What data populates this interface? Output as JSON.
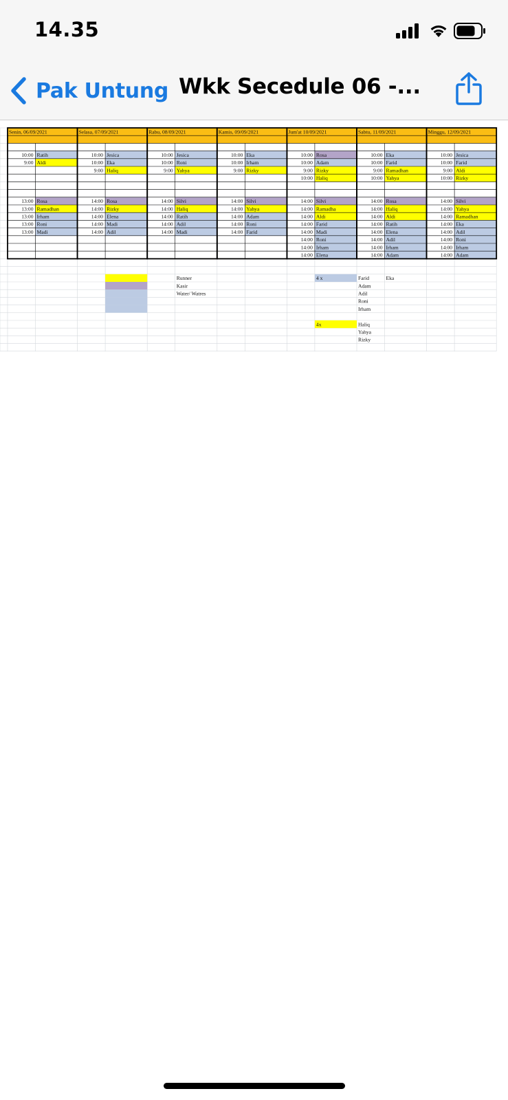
{
  "status_bar": {
    "time": "14.35"
  },
  "nav": {
    "back_label": "Pak Untung",
    "title": "Wkk Secedule 06 -..."
  },
  "colors": {
    "header": "#fbbd14",
    "runner": "#ffff00",
    "kasir": "#b3a4c8",
    "water": "#bccbe3",
    "accent": "#1a7ae0"
  },
  "icons": {
    "back": "chevron-left-icon",
    "share": "share-icon",
    "signal": "cellular-signal-icon",
    "wifi": "wifi-icon",
    "battery": "battery-icon"
  },
  "schedule": {
    "days": [
      {
        "header": "Senin, 06/09/2021",
        "morning": [
          [
            "10:00",
            "Ratih",
            "w"
          ],
          [
            "9:00",
            "Aldi",
            "y"
          ]
        ],
        "afternoon": [
          [
            "13:00",
            "Rosa",
            "p"
          ],
          [
            "13:00",
            "Ramadhan",
            "y"
          ],
          [
            "13:00",
            "Irham",
            "w"
          ],
          [
            "13:00",
            "Roni",
            "w"
          ],
          [
            "13:00",
            "Madi",
            "w"
          ]
        ]
      },
      {
        "header": "Selasa, 07/09/2021",
        "morning": [
          [
            "10:00",
            "Jesica",
            "w"
          ],
          [
            "10:00",
            "Eka",
            "w"
          ],
          [
            "9:00",
            "Haliq",
            "y"
          ]
        ],
        "afternoon": [
          [
            "14:00",
            "Rosa",
            "p"
          ],
          [
            "14:00",
            "Rizky",
            "y"
          ],
          [
            "14:00",
            "Elena",
            "w"
          ],
          [
            "14:00",
            "Madi",
            "w"
          ],
          [
            "14:00",
            "Adil",
            "w"
          ]
        ]
      },
      {
        "header": "Rabu, 08/09/2021",
        "morning": [
          [
            "10:00",
            "Jesica",
            "w"
          ],
          [
            "10:00",
            "Roni",
            "w"
          ],
          [
            "9:00",
            "Yahya",
            "y"
          ]
        ],
        "afternoon": [
          [
            "14:00",
            "Silvi",
            "p"
          ],
          [
            "14:00",
            "Haliq",
            "y"
          ],
          [
            "14:00",
            "Ratih",
            "w"
          ],
          [
            "14:00",
            "Adil",
            "w"
          ],
          [
            "14:00",
            "Madi",
            "w"
          ]
        ]
      },
      {
        "header": "Kamis, 09/09/2021",
        "morning": [
          [
            "10:00",
            "Eka",
            "w"
          ],
          [
            "10:00",
            "Irham",
            "w"
          ],
          [
            "9:00",
            "Rizky",
            "y"
          ]
        ],
        "afternoon": [
          [
            "14:00",
            "Silvi",
            "p"
          ],
          [
            "14:00",
            "Yahya",
            "y"
          ],
          [
            "14:00",
            "Adam",
            "w"
          ],
          [
            "14:00",
            "Roni",
            "w"
          ],
          [
            "14:00",
            "Farid",
            "w"
          ]
        ]
      },
      {
        "header": "Jum'at 10/09/2021",
        "morning": [
          [
            "10:00",
            "Rosa",
            "p"
          ],
          [
            "10:00",
            "Adam",
            "w"
          ],
          [
            "9:00",
            "Rizky",
            "y"
          ],
          [
            "10:00",
            "Haliq",
            "y"
          ]
        ],
        "afternoon": [
          [
            "14:00",
            "Silvi",
            "p"
          ],
          [
            "14:00",
            "Ramadha",
            "y"
          ],
          [
            "14:00",
            "Aldi",
            "y"
          ],
          [
            "14:00",
            "Farid",
            "w"
          ],
          [
            "14:00",
            "Madi",
            "w"
          ],
          [
            "14:00",
            "Roni",
            "w"
          ],
          [
            "14:00",
            "Irham",
            "w"
          ],
          [
            "14:00",
            "Elena",
            "w"
          ]
        ]
      },
      {
        "header": "Sabtu, 11/09/2021",
        "morning": [
          [
            "10:00",
            "Eka",
            "w"
          ],
          [
            "10:00",
            "Farid",
            "w"
          ],
          [
            "9:00",
            "Ramadhan",
            "y"
          ],
          [
            "10:00",
            "Yahya",
            "y"
          ]
        ],
        "afternoon": [
          [
            "14:00",
            "Rosa",
            "p"
          ],
          [
            "14:00",
            "Haliq",
            "y"
          ],
          [
            "14:00",
            "Aldi",
            "y"
          ],
          [
            "14:00",
            "Ratih",
            "w"
          ],
          [
            "14:00",
            "Elena",
            "w"
          ],
          [
            "14:00",
            "Adil",
            "w"
          ],
          [
            "14:00",
            "Irham",
            "w"
          ],
          [
            "14:00",
            "Adam",
            "w"
          ]
        ]
      },
      {
        "header": "Minggu, 12/09/2021",
        "morning": [
          [
            "10:00",
            "Jesica",
            "w"
          ],
          [
            "10:00",
            "Farid",
            "w"
          ],
          [
            "9:00",
            "Aldi",
            "y"
          ],
          [
            "10:00",
            "Rizky",
            "y"
          ]
        ],
        "afternoon": [
          [
            "14:00",
            "Silvi",
            "p"
          ],
          [
            "14:00",
            "Yahya",
            "y"
          ],
          [
            "14:00",
            "Ramadhan",
            "y"
          ],
          [
            "14:00",
            "Eka",
            "w"
          ],
          [
            "14:00",
            "Adil",
            "w"
          ],
          [
            "14:00",
            "Roni",
            "w"
          ],
          [
            "14:00",
            "Irham",
            "w"
          ],
          [
            "14:00",
            "Adam",
            "w"
          ]
        ]
      }
    ],
    "legend": [
      {
        "label": "Runner",
        "color": "y"
      },
      {
        "label": "Kasir",
        "color": "p"
      },
      {
        "label": "Water/ Watres",
        "color": "w"
      }
    ],
    "notes": {
      "group1_count": "4 x",
      "group1_names": [
        "Farid",
        "Adam",
        "Adil",
        "Roni",
        "Irham"
      ],
      "group1_extra": "Eka",
      "group2_count": "4x",
      "group2_names": [
        "Haliq",
        "Yahya",
        "Rizky"
      ]
    }
  }
}
